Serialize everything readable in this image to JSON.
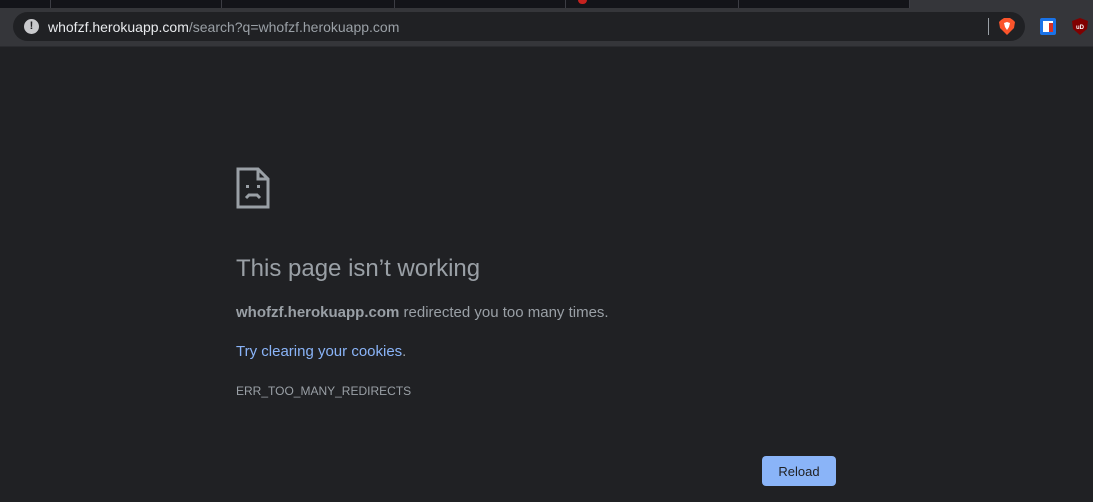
{
  "browser": {
    "address_bar": {
      "url_host": "whofzf.herokuapp.com",
      "url_rest": "/search?q=whofzf.herokuapp.com",
      "site_info_icon": "info-icon",
      "site_info_glyph": "!"
    },
    "extensions": [
      {
        "name": "brave-shields-icon",
        "color": "#fb542b"
      },
      {
        "name": "privacy-badger-icon",
        "color": "#e8eaed"
      },
      {
        "name": "ublock-origin-icon",
        "color": "#800000",
        "label": "uD"
      }
    ]
  },
  "error_page": {
    "icon": "sad-page-icon",
    "title": "This page isn’t working",
    "detail_domain": "whofzf.herokuapp.com",
    "detail_text": " redirected you too many times.",
    "suggestion_link": "Try clearing your cookies",
    "suggestion_suffix": ".",
    "error_code": "ERR_TOO_MANY_REDIRECTS",
    "reload_label": "Reload"
  },
  "colors": {
    "background": "#202124",
    "text": "#9aa0a6",
    "link": "#8ab4f8",
    "button": "#8ab4f8"
  }
}
